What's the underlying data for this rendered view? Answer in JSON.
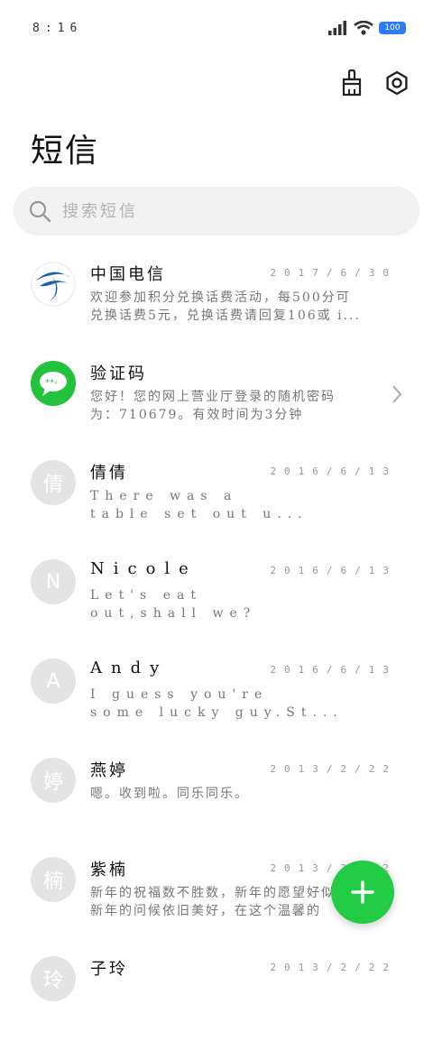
{
  "status": {
    "time": "8:16",
    "battery": "100"
  },
  "header": {
    "title": "短信"
  },
  "search": {
    "placeholder": "搜索短信"
  },
  "threads": [
    {
      "name": "中国电信",
      "date": "2017/6/30",
      "avatar": "",
      "line1": "欢迎参加积分兑换话费活动，每500分可",
      "line2": "兑换话费5元，兑换话费请回复106或 i..."
    },
    {
      "name": "验证码",
      "date": "",
      "avatar": "",
      "line1": "您好！您的网上营业厅登录的随机密码",
      "line2": "为：710679。有效时间为3分钟"
    },
    {
      "name": "倩倩",
      "date": "2016/6/13",
      "avatar": "倩",
      "line1": "There was a",
      "line2": "table set out u..."
    },
    {
      "name": "Nicole",
      "date": "2016/6/13",
      "avatar": "N",
      "line1": "Let's eat",
      "line2": "out,shall we?"
    },
    {
      "name": "Andy",
      "date": "2016/6/13",
      "avatar": "A",
      "line1": "I guess you're",
      "line2": "some lucky guy.St..."
    },
    {
      "name": "燕婷",
      "date": "2013/2/22",
      "avatar": "婷",
      "line1": "嗯。收到啦。同乐同乐。",
      "line2": ""
    },
    {
      "name": "紫楠",
      "date": "2013/2/22",
      "avatar": "楠",
      "line1": "新年的祝福数不胜数，新年的愿望好似",
      "line2": "新年的问候依旧美好，在这个温馨的"
    },
    {
      "name": "子玲",
      "date": "2013/2/22",
      "avatar": "玲",
      "line1": "",
      "line2": ""
    }
  ],
  "colors": {
    "accent": "#22cc44",
    "telecom": "#1a5fb4",
    "battery": "#2f7bf5"
  }
}
